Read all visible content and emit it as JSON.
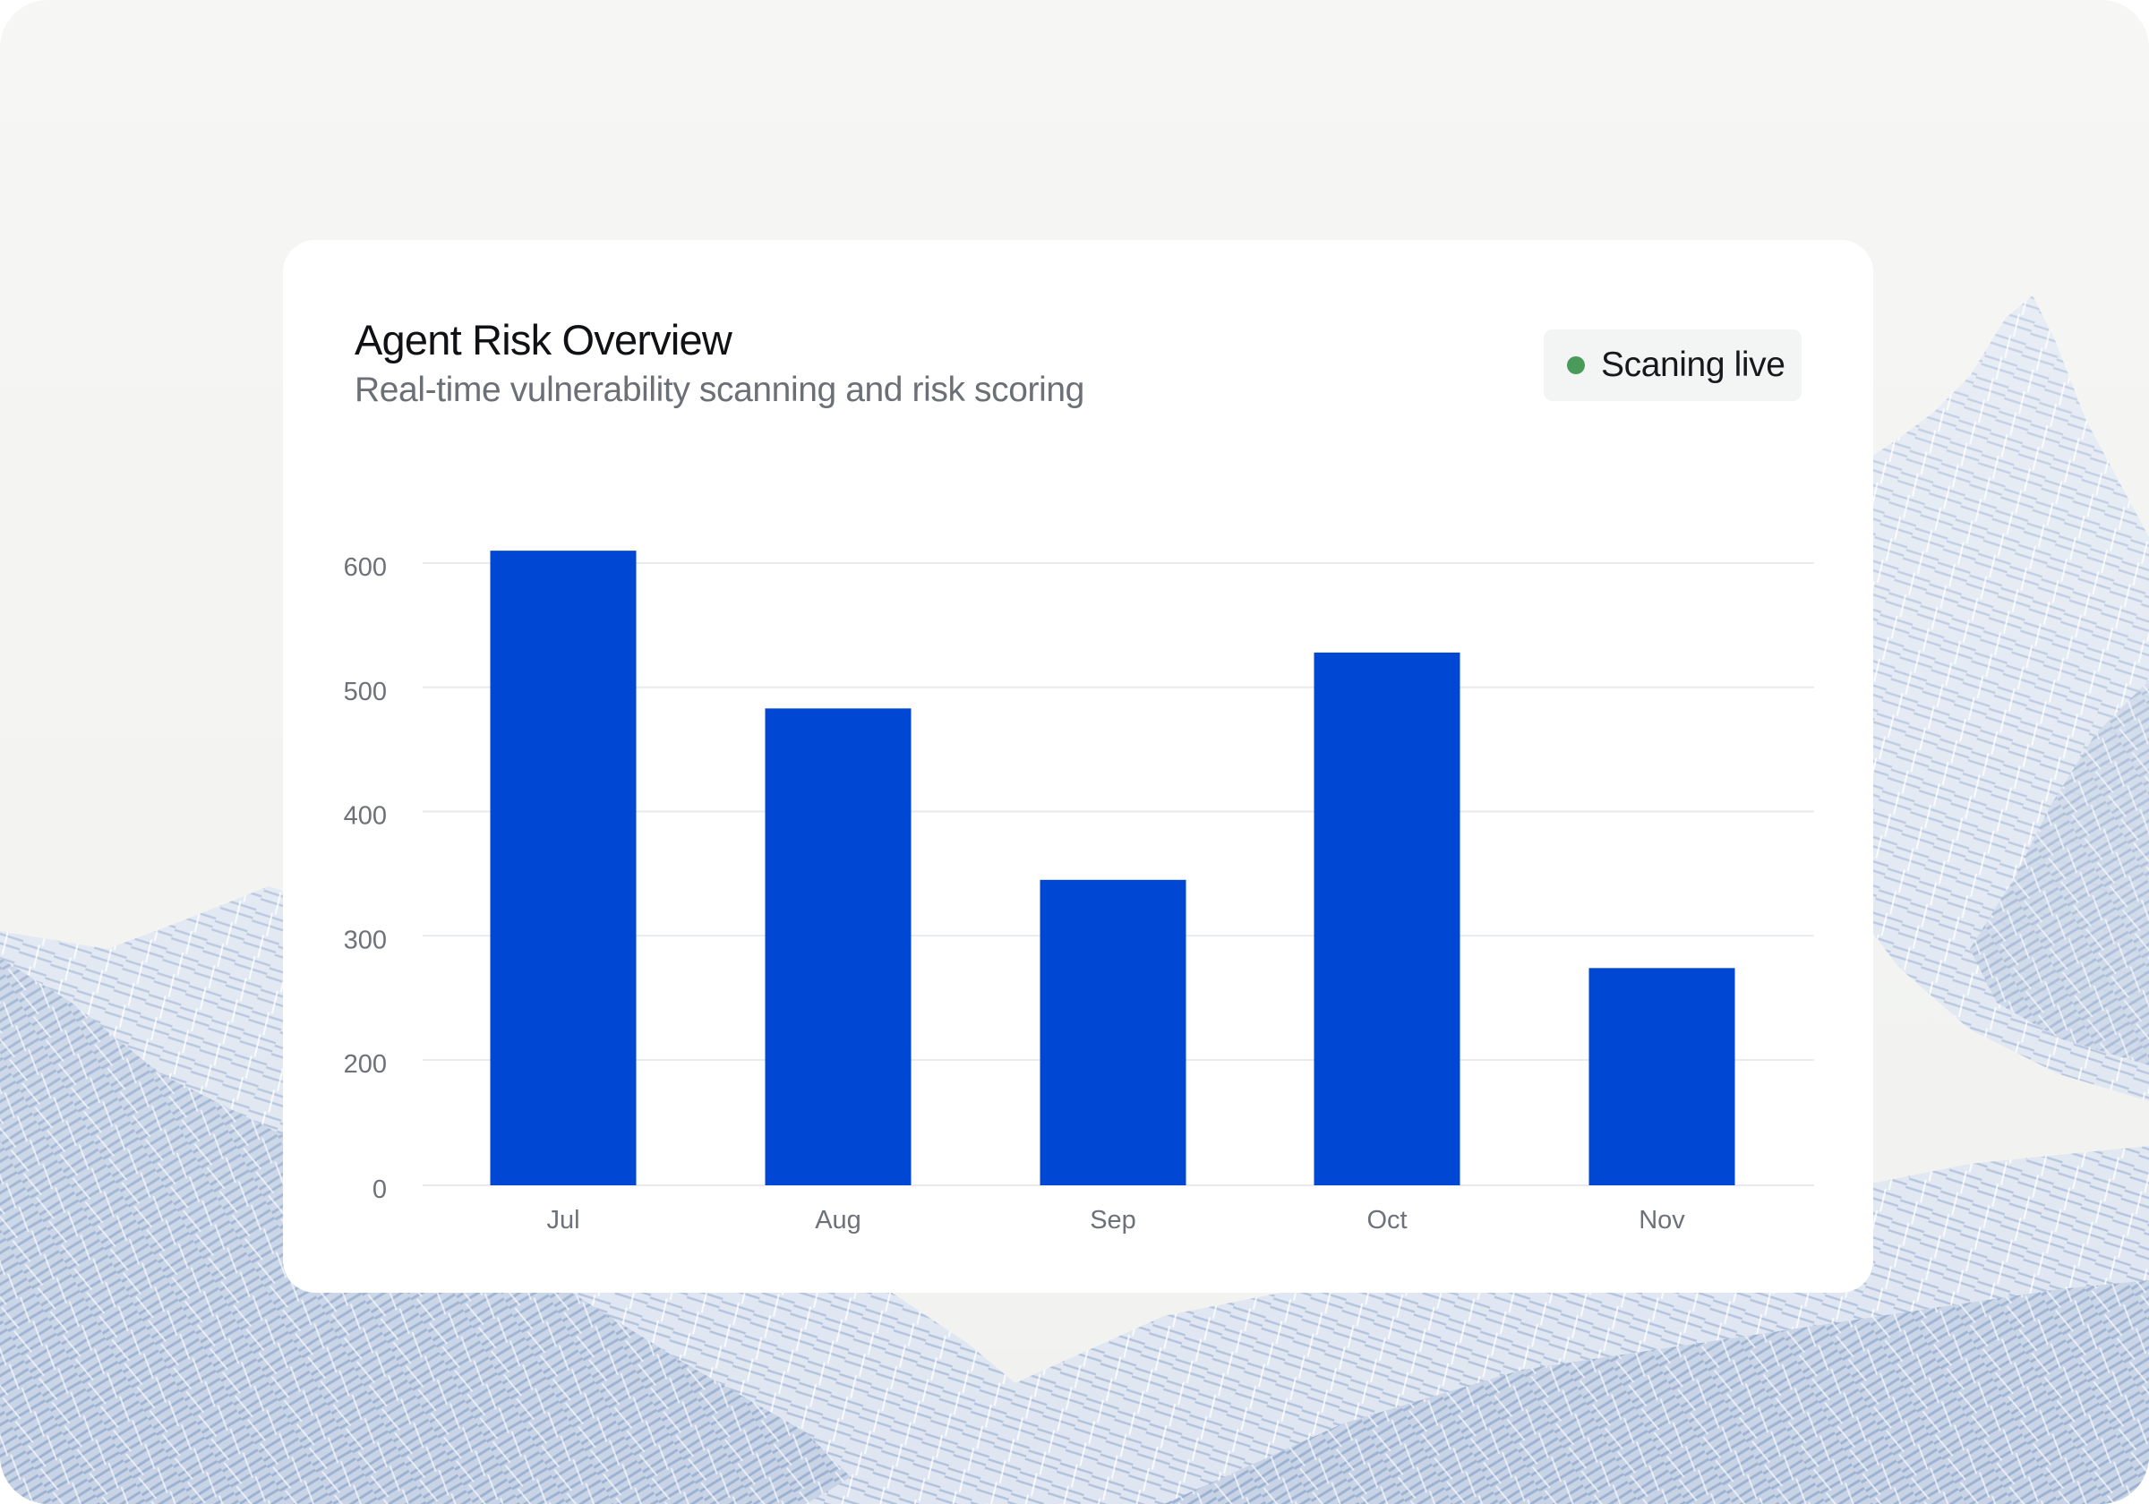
{
  "card": {
    "title": "Agent Risk Overview",
    "subtitle": "Real-time vulnerability scanning and risk scoring"
  },
  "status": {
    "label": "Scaning live",
    "dot_color": "#4a9a5a",
    "icon": "status-dot-icon"
  },
  "colors": {
    "bar": "#0048d4",
    "grid": "#e8eaed",
    "tick_text": "#6d7179",
    "background": "#f1f2ef",
    "mountain": "#a9bcd8"
  },
  "chart_data": {
    "type": "bar",
    "categories": [
      "Jul",
      "Aug",
      "Sep",
      "Oct",
      "Nov"
    ],
    "values": [
      610,
      483,
      345,
      528,
      274
    ],
    "yticks": [
      0,
      200,
      300,
      400,
      500,
      600
    ],
    "ylim": [
      0,
      600
    ],
    "grid": true
  }
}
